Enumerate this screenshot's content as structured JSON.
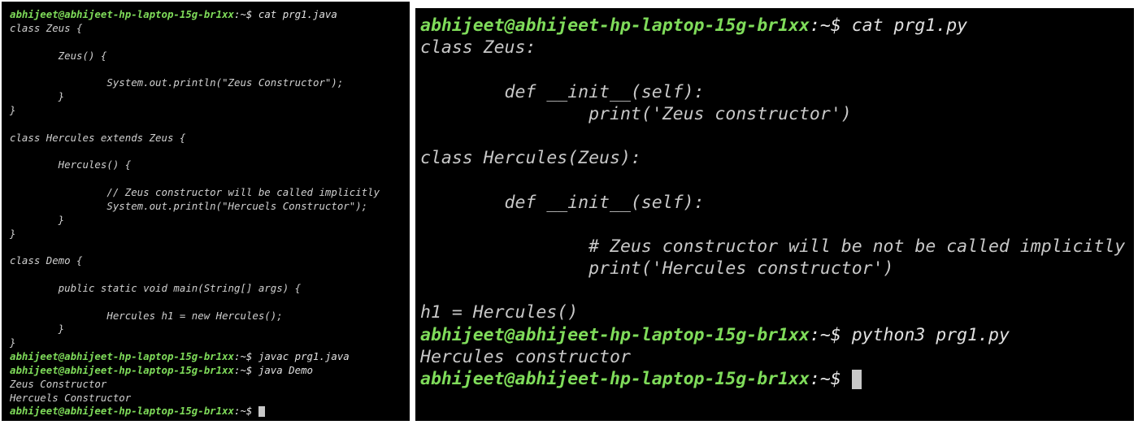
{
  "left_terminal": {
    "prompt_user": "abhijeet@abhijeet-hp-laptop-15g-br1xx",
    "prompt_path": ":~$",
    "cmd_cat": " cat prg1.java",
    "code": [
      "class Zeus {",
      "",
      "        Zeus() {",
      "",
      "                System.out.println(\"Zeus Constructor\");",
      "        }",
      "}",
      "",
      "class Hercules extends Zeus {",
      "",
      "        Hercules() {",
      "",
      "                // Zeus constructor will be called implicitly",
      "                System.out.println(\"Hercuels Constructor\");",
      "        }",
      "}",
      "",
      "class Demo {",
      "",
      "        public static void main(String[] args) {",
      "",
      "                Hercules h1 = new Hercules();",
      "        }",
      "}"
    ],
    "cmd_javac": " javac prg1.java",
    "cmd_java": " java Demo",
    "output": [
      "Zeus Constructor",
      "Hercuels Constructor"
    ]
  },
  "right_terminal": {
    "prompt_user": "abhijeet@abhijeet-hp-laptop-15g-br1xx",
    "prompt_path": ":~$",
    "cmd_cat": " cat prg1.py",
    "code": [
      "class Zeus:",
      "",
      "        def __init__(self):",
      "                print('Zeus constructor')",
      "",
      "class Hercules(Zeus):",
      "",
      "        def __init__(self):",
      "",
      "                # Zeus constructor will be not be called implicitly",
      "                print('Hercules constructor')",
      "",
      "h1 = Hercules()"
    ],
    "cmd_run": " python3 prg1.py",
    "output": [
      "Hercules constructor"
    ]
  },
  "colors": {
    "background": "#000000",
    "prompt_user": "#7fdc5a",
    "text": "#d0d0d0"
  }
}
